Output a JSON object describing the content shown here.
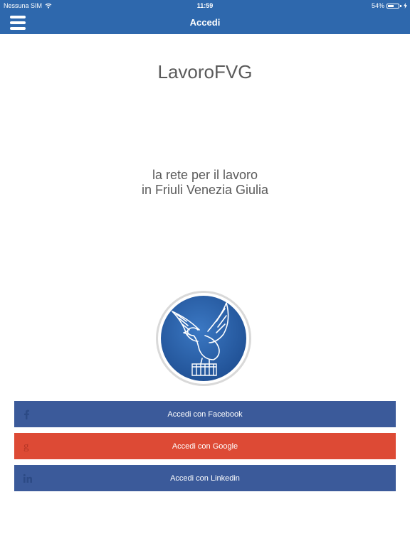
{
  "status_bar": {
    "carrier": "Nessuna SIM",
    "time": "11:59",
    "battery": "54%",
    "battery_level": 0.54
  },
  "nav": {
    "title": "Accedi"
  },
  "main": {
    "app_title": "LavoroFVG",
    "tagline_line1": "la rete per il lavoro",
    "tagline_line2": "in Friuli Venezia Giulia"
  },
  "logins": {
    "facebook": {
      "label": "Accedi con Facebook",
      "icon": "facebook-icon",
      "color": "#3b5a9a"
    },
    "google": {
      "label": "Accedi con Google",
      "icon": "google-icon",
      "color": "#dd4a35"
    },
    "linkedin": {
      "label": "Accedi con Linkedin",
      "icon": "linkedin-icon",
      "color": "#3b5a9a"
    }
  },
  "colors": {
    "nav_bar": "#2e68ad",
    "text": "#5a5a5a",
    "logo_blue": "#2b5fa8"
  }
}
